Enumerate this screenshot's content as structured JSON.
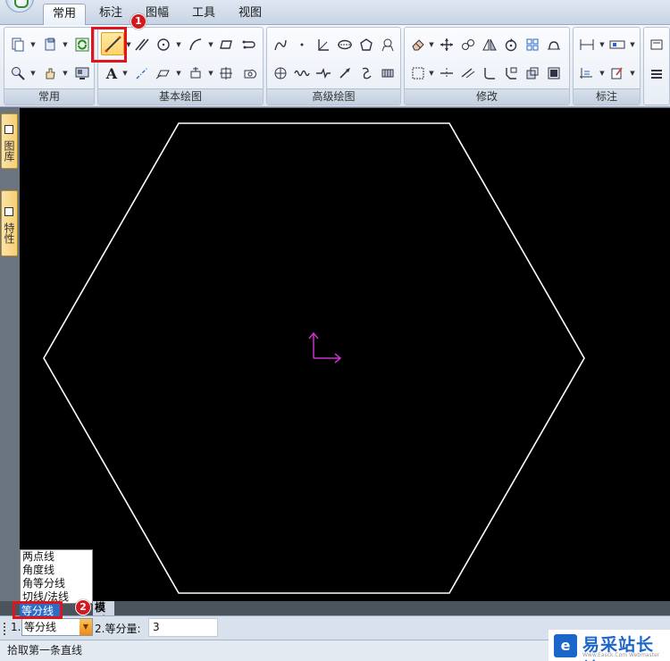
{
  "tabs": [
    {
      "label": "常用",
      "active": true
    },
    {
      "label": "标注",
      "active": false
    },
    {
      "label": "图幅",
      "active": false
    },
    {
      "label": "工具",
      "active": false
    },
    {
      "label": "视图",
      "active": false
    }
  ],
  "ribbon": {
    "groups": [
      {
        "label": "常用"
      },
      {
        "label": "基本绘图"
      },
      {
        "label": "高级绘图"
      },
      {
        "label": "修改"
      },
      {
        "label": "标注"
      }
    ]
  },
  "side_tabs": [
    {
      "label": "图库",
      "icon": "library-icon"
    },
    {
      "label": "特性",
      "icon": "properties-icon"
    }
  ],
  "annotations": {
    "badge1": "1",
    "badge2": "2"
  },
  "dropdown": {
    "options": [
      "两点线",
      "角度线",
      "角等分线",
      "切线/法线",
      "等分线"
    ],
    "selected": "等分线"
  },
  "model_tab": "模型",
  "command_bar": {
    "param1_label": "1.",
    "param1_value": "等分线",
    "param2_label": "2.等分量:",
    "param2_value": "3"
  },
  "status": "拾取第一条直线",
  "watermark": {
    "text": "易采站长站",
    "sub": "Www.Easck.Com Webmaster",
    "logo": "e"
  },
  "colors": {
    "canvas": "#000000",
    "shape": "#ffffff",
    "ucs": "#cc33cc",
    "highlight": "#e0141c"
  }
}
